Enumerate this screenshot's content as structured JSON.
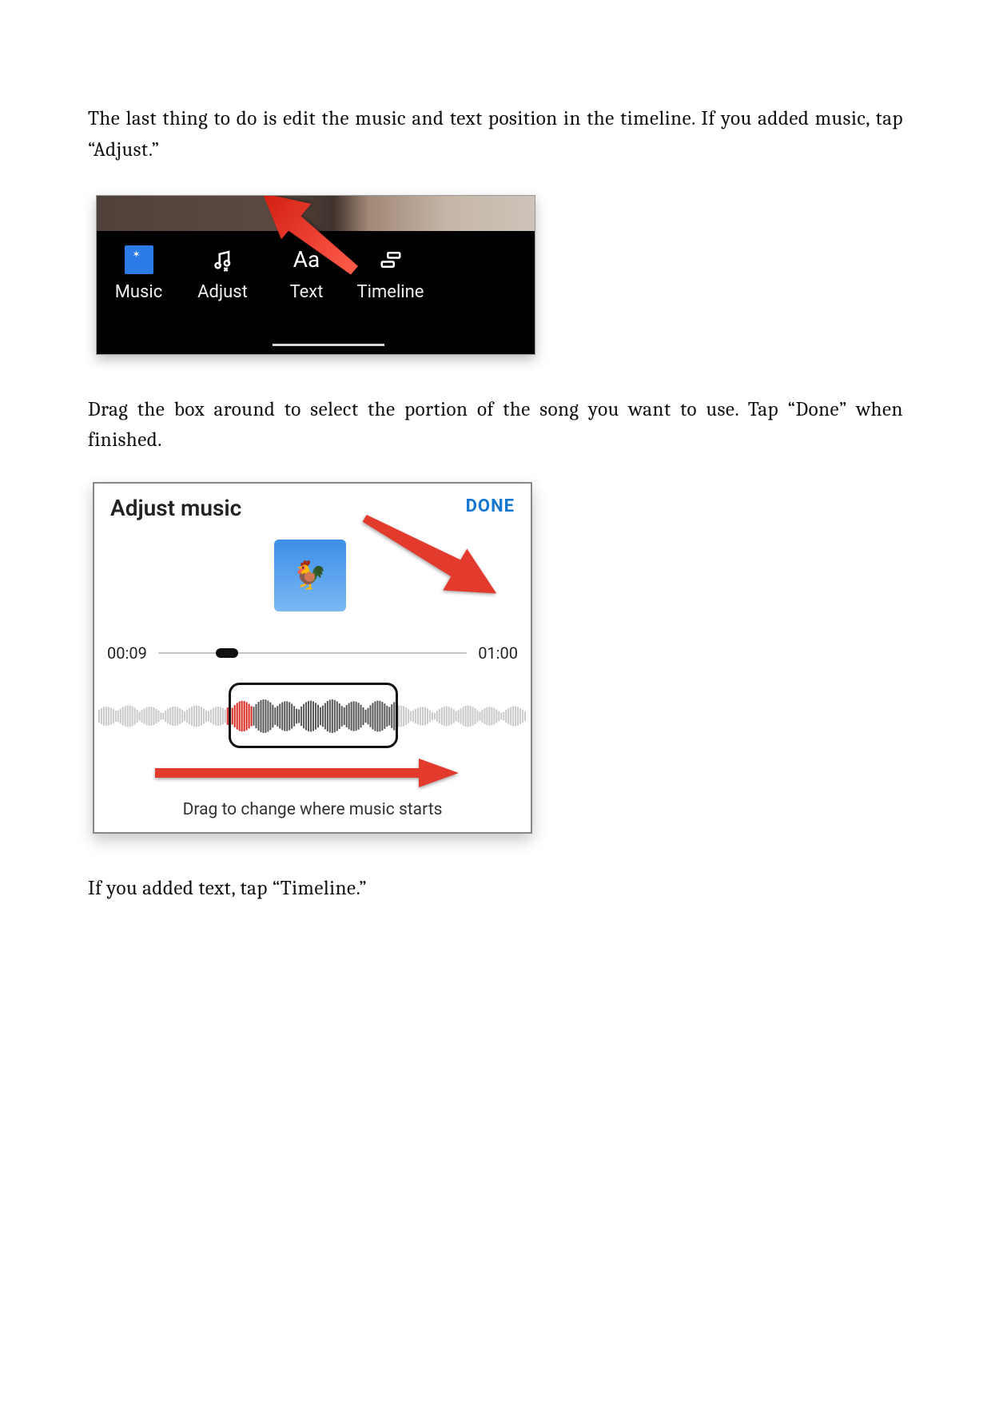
{
  "paragraphs": {
    "p1": "The last thing to do is edit the music and text position in the timeline. If you added music, tap “Adjust.”",
    "p2": "Drag the box around to select the portion of the song you want to use. Tap “Done” when finished.",
    "p3": "If you added text, tap “Timeline.”"
  },
  "figure1": {
    "toolbar": {
      "music": "Music",
      "adjust": "Adjust",
      "text_label": "Text",
      "timeline": "Timeline",
      "text_icon": "Aa"
    }
  },
  "figure2": {
    "title": "Adjust music",
    "done": "DONE",
    "time_current": "00:09",
    "time_total": "01:00",
    "caption": "Drag to change where music starts",
    "thumb_emoji": "🐓"
  }
}
